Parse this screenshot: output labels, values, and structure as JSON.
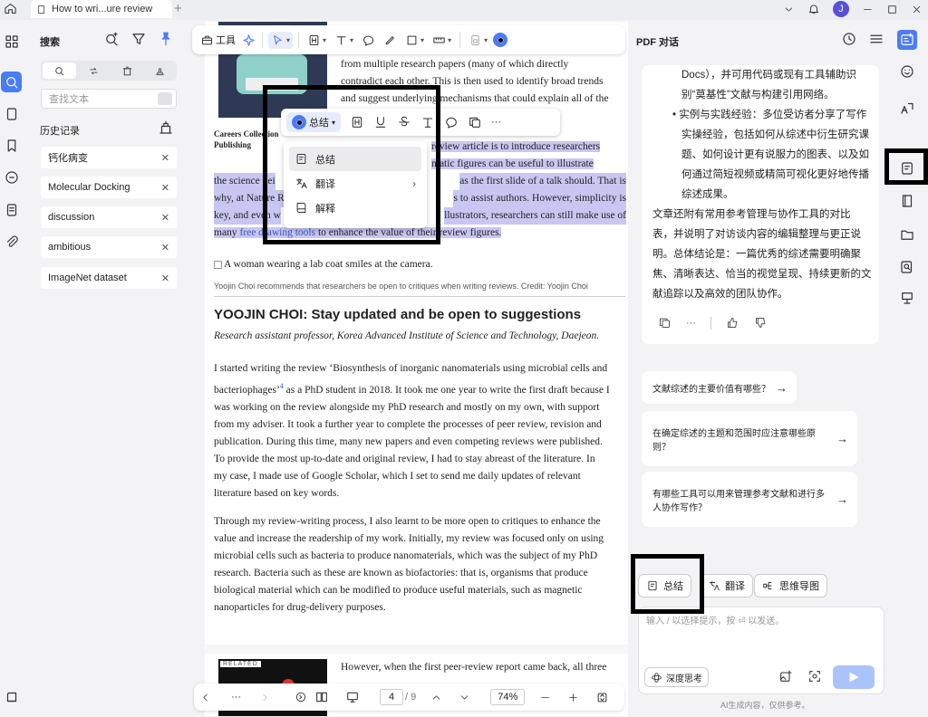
{
  "tab": {
    "title": "How to wri...ure review"
  },
  "avatar": "J",
  "search_panel": {
    "title": "搜索",
    "placeholder": "查找文本",
    "history_label": "历史记录",
    "history": [
      "钙化病变",
      "Molecular Docking",
      "discussion",
      "ambitious",
      "ImageNet dataset"
    ]
  },
  "toolbar": {
    "tools_label": "工具"
  },
  "document": {
    "top_lines": [
      "from multiple research papers (many of which directly",
      "contradict each other. This is then used to identify broad trends",
      "and suggest underlying mechanisms that could explain all of the"
    ],
    "caption_left": [
      "Careers Collection",
      "Publishing"
    ],
    "hl_lines": [
      {
        "a": "",
        "b": "review article is to introduce researchers"
      },
      {
        "a": "",
        "b": "matic figures can be useful to illustrate"
      },
      {
        "a": "the science bei",
        "b": "as the first slide of a talk should. That is"
      },
      {
        "a": "why, at Nature R",
        "b": "s to assist authors. However, simplicity is"
      },
      {
        "a": "key, and even w",
        "b": "llustrators, researchers can still make use of"
      }
    ],
    "hl_last_a": "many ",
    "hl_last_link": "free drawing tools",
    "hl_last_b": " to enhance the value of their review figures.",
    "img_alt": "A woman wearing a lab coat smiles at the camera.",
    "img_caption": "Yoojin Choi recommends that researchers be open to critiques when writing reviews.  Credit: Yoojin Choi",
    "heading": "YOOJIN CHOI: Stay updated and be open to suggestions",
    "subheading": "Research assistant professor, Korea Advanced Institute of Science and Technology, Daejeon.",
    "p1_first": "I started writing the review ‘Biosynthesis of inorganic nanomaterials using microbial cells and",
    "p1_b_pre": "bacteriophages’",
    "p1_b_sup": "4",
    "p1_b_post": " as a PhD student in 2018. It took me one year to write the first draft because I",
    "p1_rest": [
      "was working on the review alongside my PhD research and mostly on my own, with support",
      "from my adviser. It took a further year to complete the processes of peer review, revision and",
      "publication. During this time, many new papers and even competing reviews were published.",
      "To provide the most up-to-date and original review, I had to stay abreast of the literature. In",
      "my case, I made use of Google Scholar, which I set to send me daily updates of relevant",
      "literature based on key words."
    ],
    "p2": [
      "Through my review-writing process, I also learnt to be more open to critiques to enhance the",
      "value and increase the readership of my work. Initially, my review was focused only on using",
      "microbial cells such as bacteria to produce nanomaterials, which was the subject of my PhD",
      "research. Bacteria such as these are known as biofactories: that is, organisms that produce",
      "biological material which can be modified to produce useful materials, such as magnetic",
      "nanoparticles for drug-delivery purposes."
    ],
    "related_label": "RELATED",
    "bottom_line": "However, when the first peer-review report came back, all three"
  },
  "popup": {
    "summary": "总结"
  },
  "context_menu": {
    "items": [
      "总结",
      "翻译",
      "解释"
    ]
  },
  "bottom_bar": {
    "more": "···",
    "page": "4",
    "total": "/ 9",
    "zoom": "74%"
  },
  "right_panel": {
    "title": "PDF 对话",
    "answer_lines": [
      "Docs），并可用代码或现有工具辅助识",
      "别“莫基性”文献与构建引用网络。",
      "实例与实践经验：多位受访者分享了写作",
      "实操经验，包括如何从综述中衍生研究课",
      "题、如何设计更有说服力的图表、以及如",
      "何通过简短视频或精简可视化更好地传播",
      "综述成果。",
      "文章还附有常用参考管理与协作工具的对比",
      "表，并说明了对访谈内容的编辑整理与更正说",
      "明。总体结论是：一篇优秀的综述需要明确聚",
      "焦、清晰表达、恰当的视觉呈现、持续更新的文",
      "献追踪以及高效的团队协作。"
    ],
    "suggestions": [
      "文献综述的主要价值有哪些？",
      "在确定综述的主题和范围时应注意哪些原则？",
      "有哪些工具可以用来管理参考文献和进行多人协作写作？"
    ],
    "actions": [
      "总结",
      "翻译",
      "思维导图"
    ],
    "input_placeholder": "输入 / 以选择提示，按 ⏎ 以发送。",
    "deep_think": "深度思考",
    "footnote": "AI生成内容，仅供参考。"
  }
}
